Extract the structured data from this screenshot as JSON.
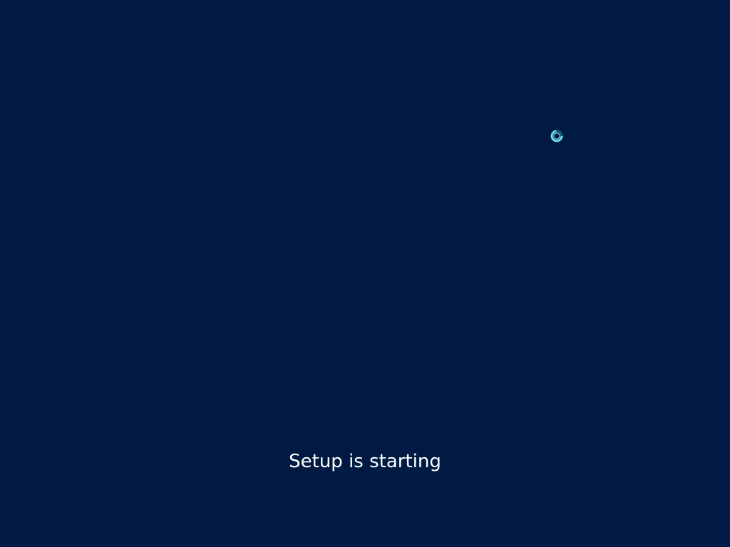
{
  "screen": {
    "status_text": "Setup is starting",
    "background_color": "#001a43",
    "text_color": "#ffffff"
  },
  "cursor": {
    "icon": "busy-cursor-icon",
    "ring_color": "#6fe3ff",
    "ring_shadow_color": "#0a5f7a"
  }
}
